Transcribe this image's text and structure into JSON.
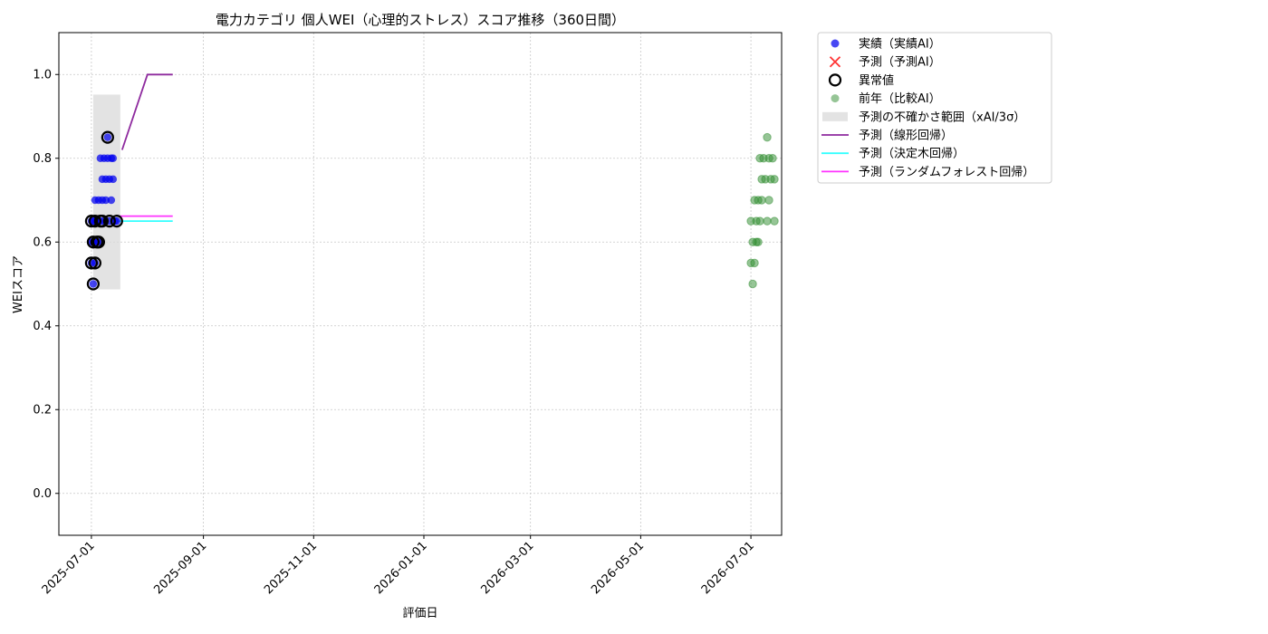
{
  "chart_data": {
    "type": "scatter",
    "title": "電力カテゴリ 個人WEI（心理的ストレス）スコア推移（360日間）",
    "xlabel": "評価日",
    "ylabel": "WEIスコア",
    "xlim": [
      "2025-06-13",
      "2026-07-18"
    ],
    "ylim": [
      -0.1,
      1.1
    ],
    "grid": true,
    "legend_position": "outside right, top",
    "x_ticks": [
      "2025-07-01",
      "2025-09-01",
      "2025-11-01",
      "2026-01-01",
      "2026-03-01",
      "2026-05-01",
      "2026-07-01"
    ],
    "y_ticks": [
      "0.0",
      "0.2",
      "0.4",
      "0.6",
      "0.8",
      "1.0"
    ],
    "legend": [
      {
        "label": "実績（実績AI）",
        "kind": "dot",
        "color": "#0000ee"
      },
      {
        "label": "予測（予測AI）",
        "kind": "cross",
        "color": "#ff3333"
      },
      {
        "label": "異常値",
        "kind": "ring",
        "color": "#000000"
      },
      {
        "label": "前年（比較AI）",
        "kind": "dot-faded",
        "color": "#2e8b2e"
      },
      {
        "label": "予測の不確かさ範囲（xAI/3σ）",
        "kind": "band",
        "color": "#d9d9d9"
      },
      {
        "label": "予測（線形回帰）",
        "kind": "line",
        "color": "#8e2a9e"
      },
      {
        "label": "予測（決定木回帰）",
        "kind": "line",
        "color": "#33ffff"
      },
      {
        "label": "予測（ランダムフォレスト回帰）",
        "kind": "line",
        "color": "#ff33ff"
      }
    ],
    "series": [
      {
        "name": "実績（実績AI）",
        "color": "#0000ee",
        "points": [
          [
            "2025-07-01",
            0.65
          ],
          [
            "2025-07-01",
            0.55
          ],
          [
            "2025-07-01",
            0.6
          ],
          [
            "2025-07-02",
            0.5
          ],
          [
            "2025-07-02",
            0.65
          ],
          [
            "2025-07-02",
            0.6
          ],
          [
            "2025-07-03",
            0.7
          ],
          [
            "2025-07-03",
            0.55
          ],
          [
            "2025-07-03",
            0.65
          ],
          [
            "2025-07-04",
            0.6
          ],
          [
            "2025-07-04",
            0.65
          ],
          [
            "2025-07-05",
            0.7
          ],
          [
            "2025-07-05",
            0.6
          ],
          [
            "2025-07-06",
            0.65
          ],
          [
            "2025-07-06",
            0.8
          ],
          [
            "2025-07-07",
            0.7
          ],
          [
            "2025-07-07",
            0.75
          ],
          [
            "2025-07-08",
            0.8
          ],
          [
            "2025-07-08",
            0.65
          ],
          [
            "2025-07-09",
            0.75
          ],
          [
            "2025-07-09",
            0.7
          ],
          [
            "2025-07-10",
            0.85
          ],
          [
            "2025-07-10",
            0.8
          ],
          [
            "2025-07-11",
            0.75
          ],
          [
            "2025-07-11",
            0.65
          ],
          [
            "2025-07-12",
            0.7
          ],
          [
            "2025-07-12",
            0.8
          ],
          [
            "2025-07-13",
            0.75
          ],
          [
            "2025-07-13",
            0.8
          ],
          [
            "2025-07-14",
            0.65
          ],
          [
            "2025-07-15",
            0.65
          ]
        ]
      },
      {
        "name": "異常値",
        "color": "#000000",
        "points": [
          [
            "2025-07-01",
            0.65
          ],
          [
            "2025-07-01",
            0.55
          ],
          [
            "2025-07-02",
            0.5
          ],
          [
            "2025-07-02",
            0.6
          ],
          [
            "2025-07-03",
            0.55
          ],
          [
            "2025-07-03",
            0.65
          ],
          [
            "2025-07-04",
            0.6
          ],
          [
            "2025-07-05",
            0.6
          ],
          [
            "2025-07-06",
            0.65
          ],
          [
            "2025-07-07",
            0.65
          ],
          [
            "2025-07-10",
            0.85
          ],
          [
            "2025-07-11",
            0.65
          ],
          [
            "2025-07-15",
            0.65
          ]
        ]
      },
      {
        "name": "前年（比較AI）",
        "color": "#2e8b2e",
        "points": [
          [
            "2026-07-01",
            0.55
          ],
          [
            "2026-07-01",
            0.65
          ],
          [
            "2026-07-02",
            0.5
          ],
          [
            "2026-07-02",
            0.6
          ],
          [
            "2026-07-03",
            0.7
          ],
          [
            "2026-07-03",
            0.55
          ],
          [
            "2026-07-04",
            0.65
          ],
          [
            "2026-07-04",
            0.6
          ],
          [
            "2026-07-05",
            0.6
          ],
          [
            "2026-07-05",
            0.7
          ],
          [
            "2026-07-06",
            0.8
          ],
          [
            "2026-07-06",
            0.65
          ],
          [
            "2026-07-07",
            0.75
          ],
          [
            "2026-07-07",
            0.7
          ],
          [
            "2026-07-08",
            0.8
          ],
          [
            "2026-07-09",
            0.75
          ],
          [
            "2026-07-10",
            0.85
          ],
          [
            "2026-07-10",
            0.65
          ],
          [
            "2026-07-11",
            0.7
          ],
          [
            "2026-07-11",
            0.8
          ],
          [
            "2026-07-12",
            0.75
          ],
          [
            "2026-07-13",
            0.8
          ],
          [
            "2026-07-14",
            0.65
          ],
          [
            "2026-07-14",
            0.75
          ]
        ]
      }
    ],
    "uncertainty_band": {
      "x_start": "2025-07-02",
      "x_end": "2025-07-17",
      "y_low": 0.487,
      "y_high": 0.952,
      "color": "#d9d9d9"
    },
    "prediction_lines": [
      {
        "name": "予測（線形回帰）",
        "color": "#8e2a9e",
        "points": [
          [
            "2025-07-18",
            0.82
          ],
          [
            "2025-08-01",
            1.0
          ],
          [
            "2025-08-15",
            1.0
          ]
        ]
      },
      {
        "name": "予測（決定木回帰）",
        "color": "#33ffff",
        "points": [
          [
            "2025-07-16",
            0.65
          ],
          [
            "2025-08-15",
            0.65
          ]
        ]
      },
      {
        "name": "予測（ランダムフォレスト回帰）",
        "color": "#ff33ff",
        "points": [
          [
            "2025-07-16",
            0.662
          ],
          [
            "2025-08-15",
            0.662
          ]
        ]
      }
    ]
  }
}
